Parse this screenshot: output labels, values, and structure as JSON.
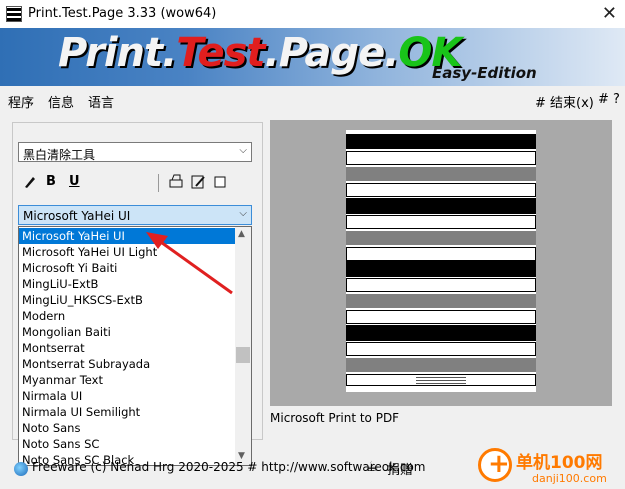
{
  "window": {
    "title": "Print.Test.Page 3.33  (wow64)",
    "close": "✕"
  },
  "banner": {
    "part1": "Print.",
    "part2": "Test",
    "part3": ".Page.",
    "part4": "OK",
    "edition": "Easy-Edition"
  },
  "menu": {
    "program": "程序",
    "info": "信息",
    "language": "语言",
    "exit": "# 结束(x)",
    "help": "# ?"
  },
  "tool_combo": {
    "value": "黑白清除工具"
  },
  "toolbar": {
    "bold": "B",
    "underline": "U"
  },
  "font_combo": {
    "value": "Microsoft YaHei UI"
  },
  "font_list": [
    "Microsoft YaHei UI",
    "Microsoft YaHei UI Light",
    "Microsoft Yi Baiti",
    "MingLiU-ExtB",
    "MingLiU_HKSCS-ExtB",
    "Modern",
    "Mongolian Baiti",
    "Montserrat",
    "Montserrat Subrayada",
    "Myanmar Text",
    "Nirmala UI",
    "Nirmala UI Semilight",
    "Noto Sans",
    "Noto Sans SC",
    "Noto Sans SC Black"
  ],
  "preview": {
    "printer": "Microsoft Print to PDF"
  },
  "status": {
    "text": "Freeware (c) Nenad Hrg 2020-2025 # http://www.softwareok.com",
    "donate": "捐赠"
  },
  "watermark": {
    "text": "单机100网",
    "sub": "danji100.com"
  },
  "colors": {
    "accent": "#0078d7",
    "annotation": "#e02020",
    "watermark": "#ff7a00"
  }
}
